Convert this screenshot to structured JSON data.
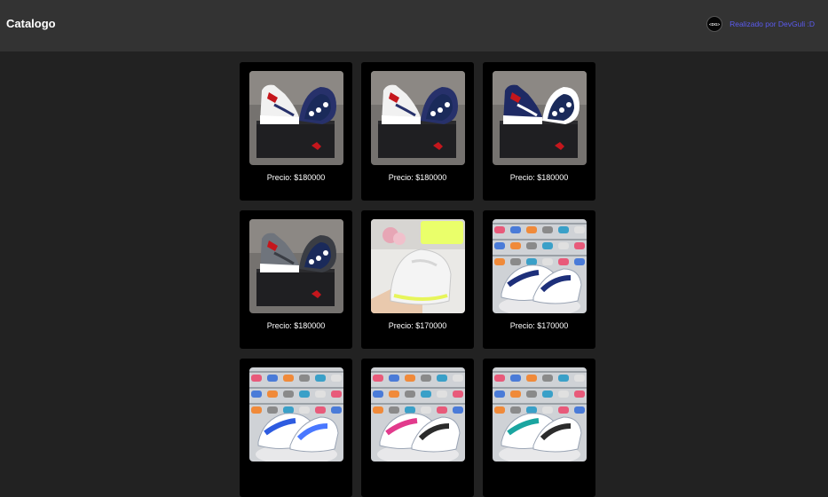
{
  "header": {
    "title": "Catalogo",
    "credit_logo_text": "<DG>",
    "credit_text": "Realizado por DevGuli :D"
  },
  "products": [
    {
      "price": "Precio: $180000",
      "theme": "navy-white",
      "image": "red-navy-white sneaker pair on black shoebox"
    },
    {
      "price": "Precio: $180000",
      "theme": "navy-white",
      "image": "red-navy-white sneaker pair on black shoebox"
    },
    {
      "price": "Precio: $180000",
      "theme": "navy",
      "image": "navy sneaker pair on black shoebox"
    },
    {
      "price": "Precio: $180000",
      "theme": "grey",
      "image": "grey-red sneaker pair on black shoebox"
    },
    {
      "price": "Precio: $170000",
      "theme": "white-yellow",
      "image": "white-yellow sneaker held in hand"
    },
    {
      "price": "Precio: $170000",
      "theme": "shelf-navy",
      "image": "navy-white sneaker pair in store"
    },
    {
      "price": "",
      "theme": "shelf-blue",
      "image": "white-blue sneaker pair in store"
    },
    {
      "price": "",
      "theme": "shelf-pink",
      "image": "white-pink sneaker pair in store"
    },
    {
      "price": "",
      "theme": "shelf-teal",
      "image": "white-teal sneaker pair in store"
    }
  ],
  "colors": {
    "page_bg": "#222222",
    "header_bg": "#333333",
    "card_bg": "#000000",
    "credit_link": "#5b5bf0"
  }
}
